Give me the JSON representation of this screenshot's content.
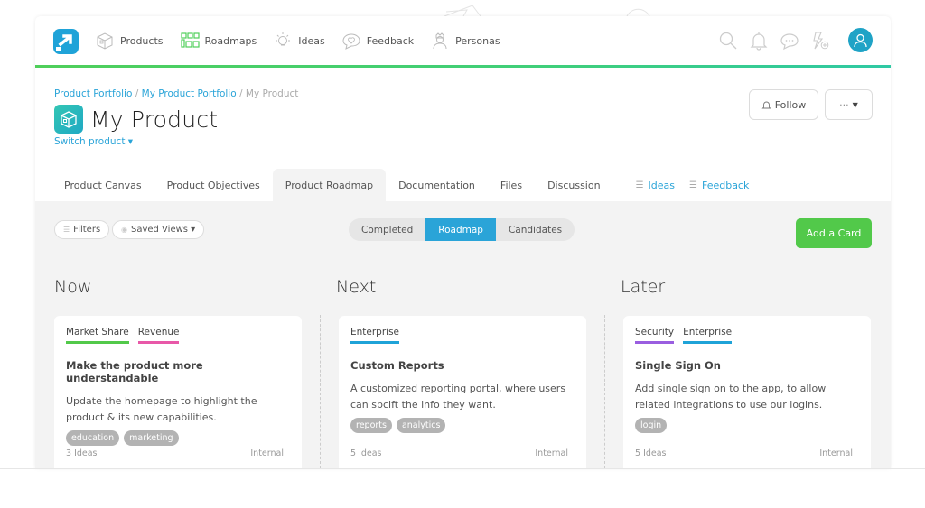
{
  "nav": {
    "items": [
      {
        "label": "Products",
        "icon": "box-icon"
      },
      {
        "label": "Roadmaps",
        "icon": "grid-icon"
      },
      {
        "label": "Ideas",
        "icon": "lightbulb-icon"
      },
      {
        "label": "Feedback",
        "icon": "heart-bubble-icon"
      },
      {
        "label": "Personas",
        "icon": "persona-icon"
      }
    ],
    "right_icons": [
      "search-icon",
      "bell-icon",
      "chat-icon",
      "quick-add-icon",
      "user-avatar-icon"
    ]
  },
  "colors": {
    "accent": "#2aa4d8",
    "success": "#52c94a",
    "nav_bar_start": "#4fcf5a",
    "nav_bar_end": "#2fc9a4"
  },
  "header": {
    "breadcrumb": [
      {
        "label": "Product Portfolio",
        "link": true
      },
      {
        "label": "My Product Portfolio",
        "link": true
      },
      {
        "label": "My Product",
        "link": false
      }
    ],
    "separator": "/",
    "title": "My Product",
    "switch_label": "Switch product ▾",
    "follow_label": "Follow",
    "more_label": "···"
  },
  "tabs": [
    {
      "label": "Product Canvas"
    },
    {
      "label": "Product Objectives"
    },
    {
      "label": "Product Roadmap",
      "active": true
    },
    {
      "label": "Documentation"
    },
    {
      "label": "Files"
    },
    {
      "label": "Discussion"
    }
  ],
  "filter_tabs": [
    {
      "label": "Ideas"
    },
    {
      "label": "Feedback"
    }
  ],
  "toolbar": {
    "filters_label": "Filters",
    "saved_views_label": "Saved Views ▾",
    "segments": [
      {
        "label": "Completed"
      },
      {
        "label": "Roadmap",
        "active": true
      },
      {
        "label": "Candidates"
      }
    ],
    "add_card_label": "Add a Card"
  },
  "columns": [
    {
      "title": "Now",
      "card": {
        "themes": [
          {
            "label": "Market Share",
            "color": "#52c94a"
          },
          {
            "label": "Revenue",
            "color": "#e858a8"
          }
        ],
        "title": "Make the product more understandable",
        "description": "Update the homepage to highlight the product & its new capabilities.",
        "tags": [
          "education",
          "marketing"
        ],
        "ideas": "3 Ideas",
        "visibility": "Internal"
      }
    },
    {
      "title": "Next",
      "card": {
        "themes": [
          {
            "label": "Enterprise",
            "color": "#1fa3d8"
          }
        ],
        "title": "Custom Reports",
        "description": "A customized reporting portal, where users can spcift the info they want.",
        "tags": [
          "reports",
          "analytics"
        ],
        "ideas": "5 Ideas",
        "visibility": "Internal"
      }
    },
    {
      "title": "Later",
      "card": {
        "themes": [
          {
            "label": "Security",
            "color": "#9a5ee0"
          },
          {
            "label": "Enterprise",
            "color": "#1fa3d8"
          }
        ],
        "title": "Single Sign On",
        "description": "Add single sign on to the app, to allow related integrations to use our logins.",
        "tags": [
          "login"
        ],
        "ideas": "5 Ideas",
        "visibility": "Internal"
      }
    }
  ]
}
